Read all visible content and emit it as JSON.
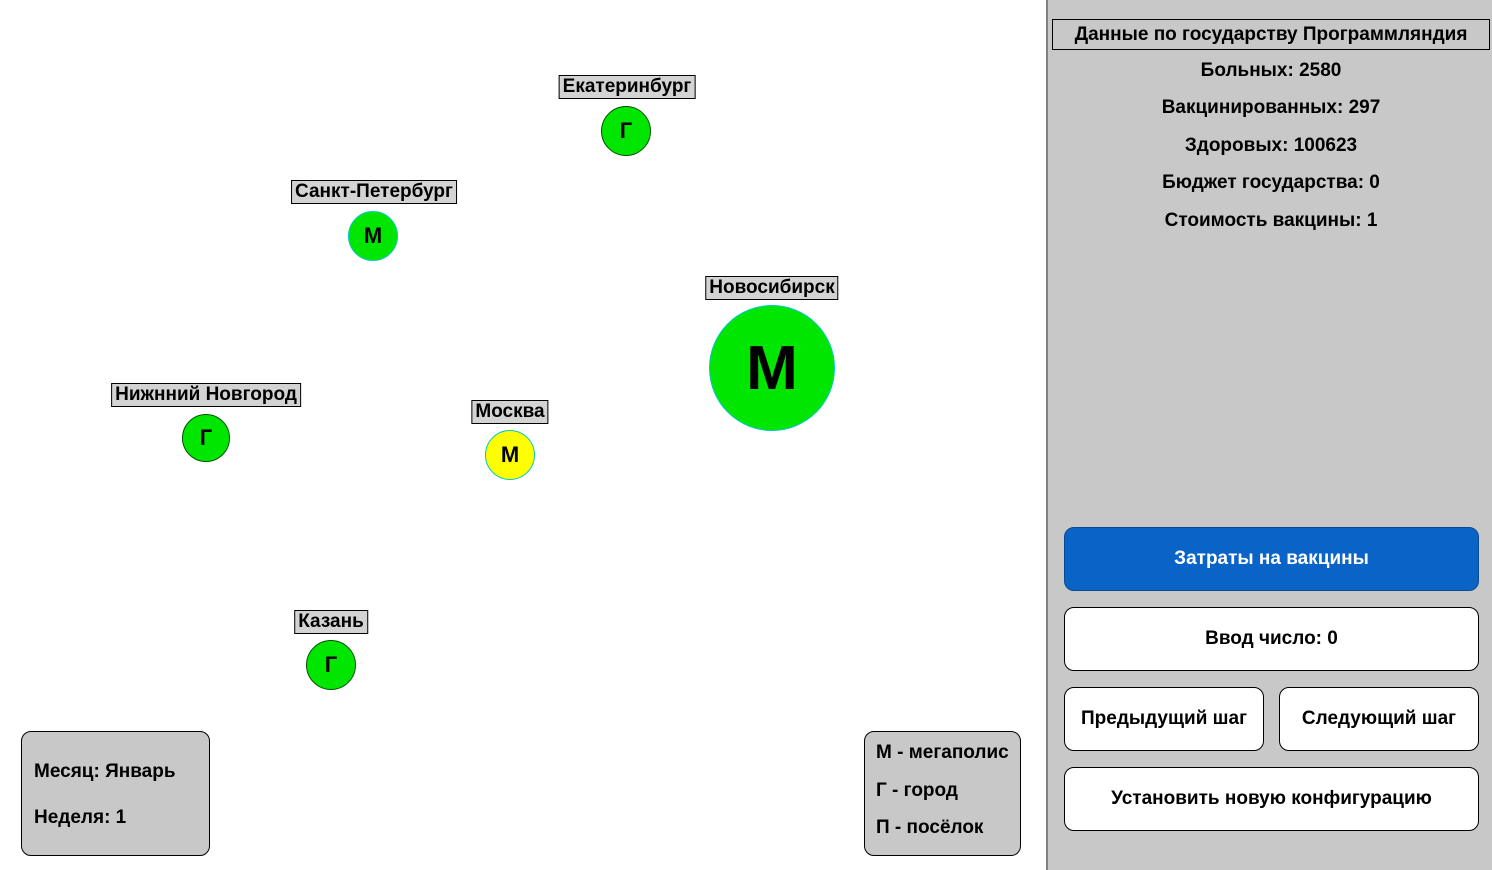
{
  "map": {
    "cities": [
      {
        "name": "Екатеринбург",
        "type_letter": "Г",
        "status_color": "#00e600"
      },
      {
        "name": "Санкт-Петербург",
        "type_letter": "М",
        "status_color": "#00e600"
      },
      {
        "name": "Новосибирск",
        "type_letter": "М",
        "status_color": "#00e600"
      },
      {
        "name": "Нижнний Новгород",
        "type_letter": "Г",
        "status_color": "#00e600"
      },
      {
        "name": "Москва",
        "type_letter": "М",
        "status_color": "#ffff00"
      },
      {
        "name": "Казань",
        "type_letter": "Г",
        "status_color": "#00e600"
      }
    ]
  },
  "date_box": {
    "month": "Месяц: Январь",
    "week": "Неделя: 1"
  },
  "legend": {
    "megapolis": "М - мегаполис",
    "city": "Г - город",
    "village": "П - посёлок"
  },
  "panel": {
    "title": "Данные по государству Программляндия",
    "sick": "Больных: 2580",
    "vaccinated": "Вакцинированных: 297",
    "healthy": "Здоровых: 100623",
    "budget": "Бюджет государства: 0",
    "vaccine_cost": "Стоимость вакцины: 1"
  },
  "buttons": {
    "vaccine_costs": "Затраты на вакцины",
    "number_input": "Ввод число: 0",
    "prev_step": "Предыдущий шаг",
    "next_step": "Следующий шаг",
    "new_config": "Установить новую конфигурацию"
  },
  "colors": {
    "healthy_city": "#00e600",
    "infected_city": "#ffff00",
    "primary_button": "#0a64c8",
    "panel_bg": "#c8c8c8"
  }
}
